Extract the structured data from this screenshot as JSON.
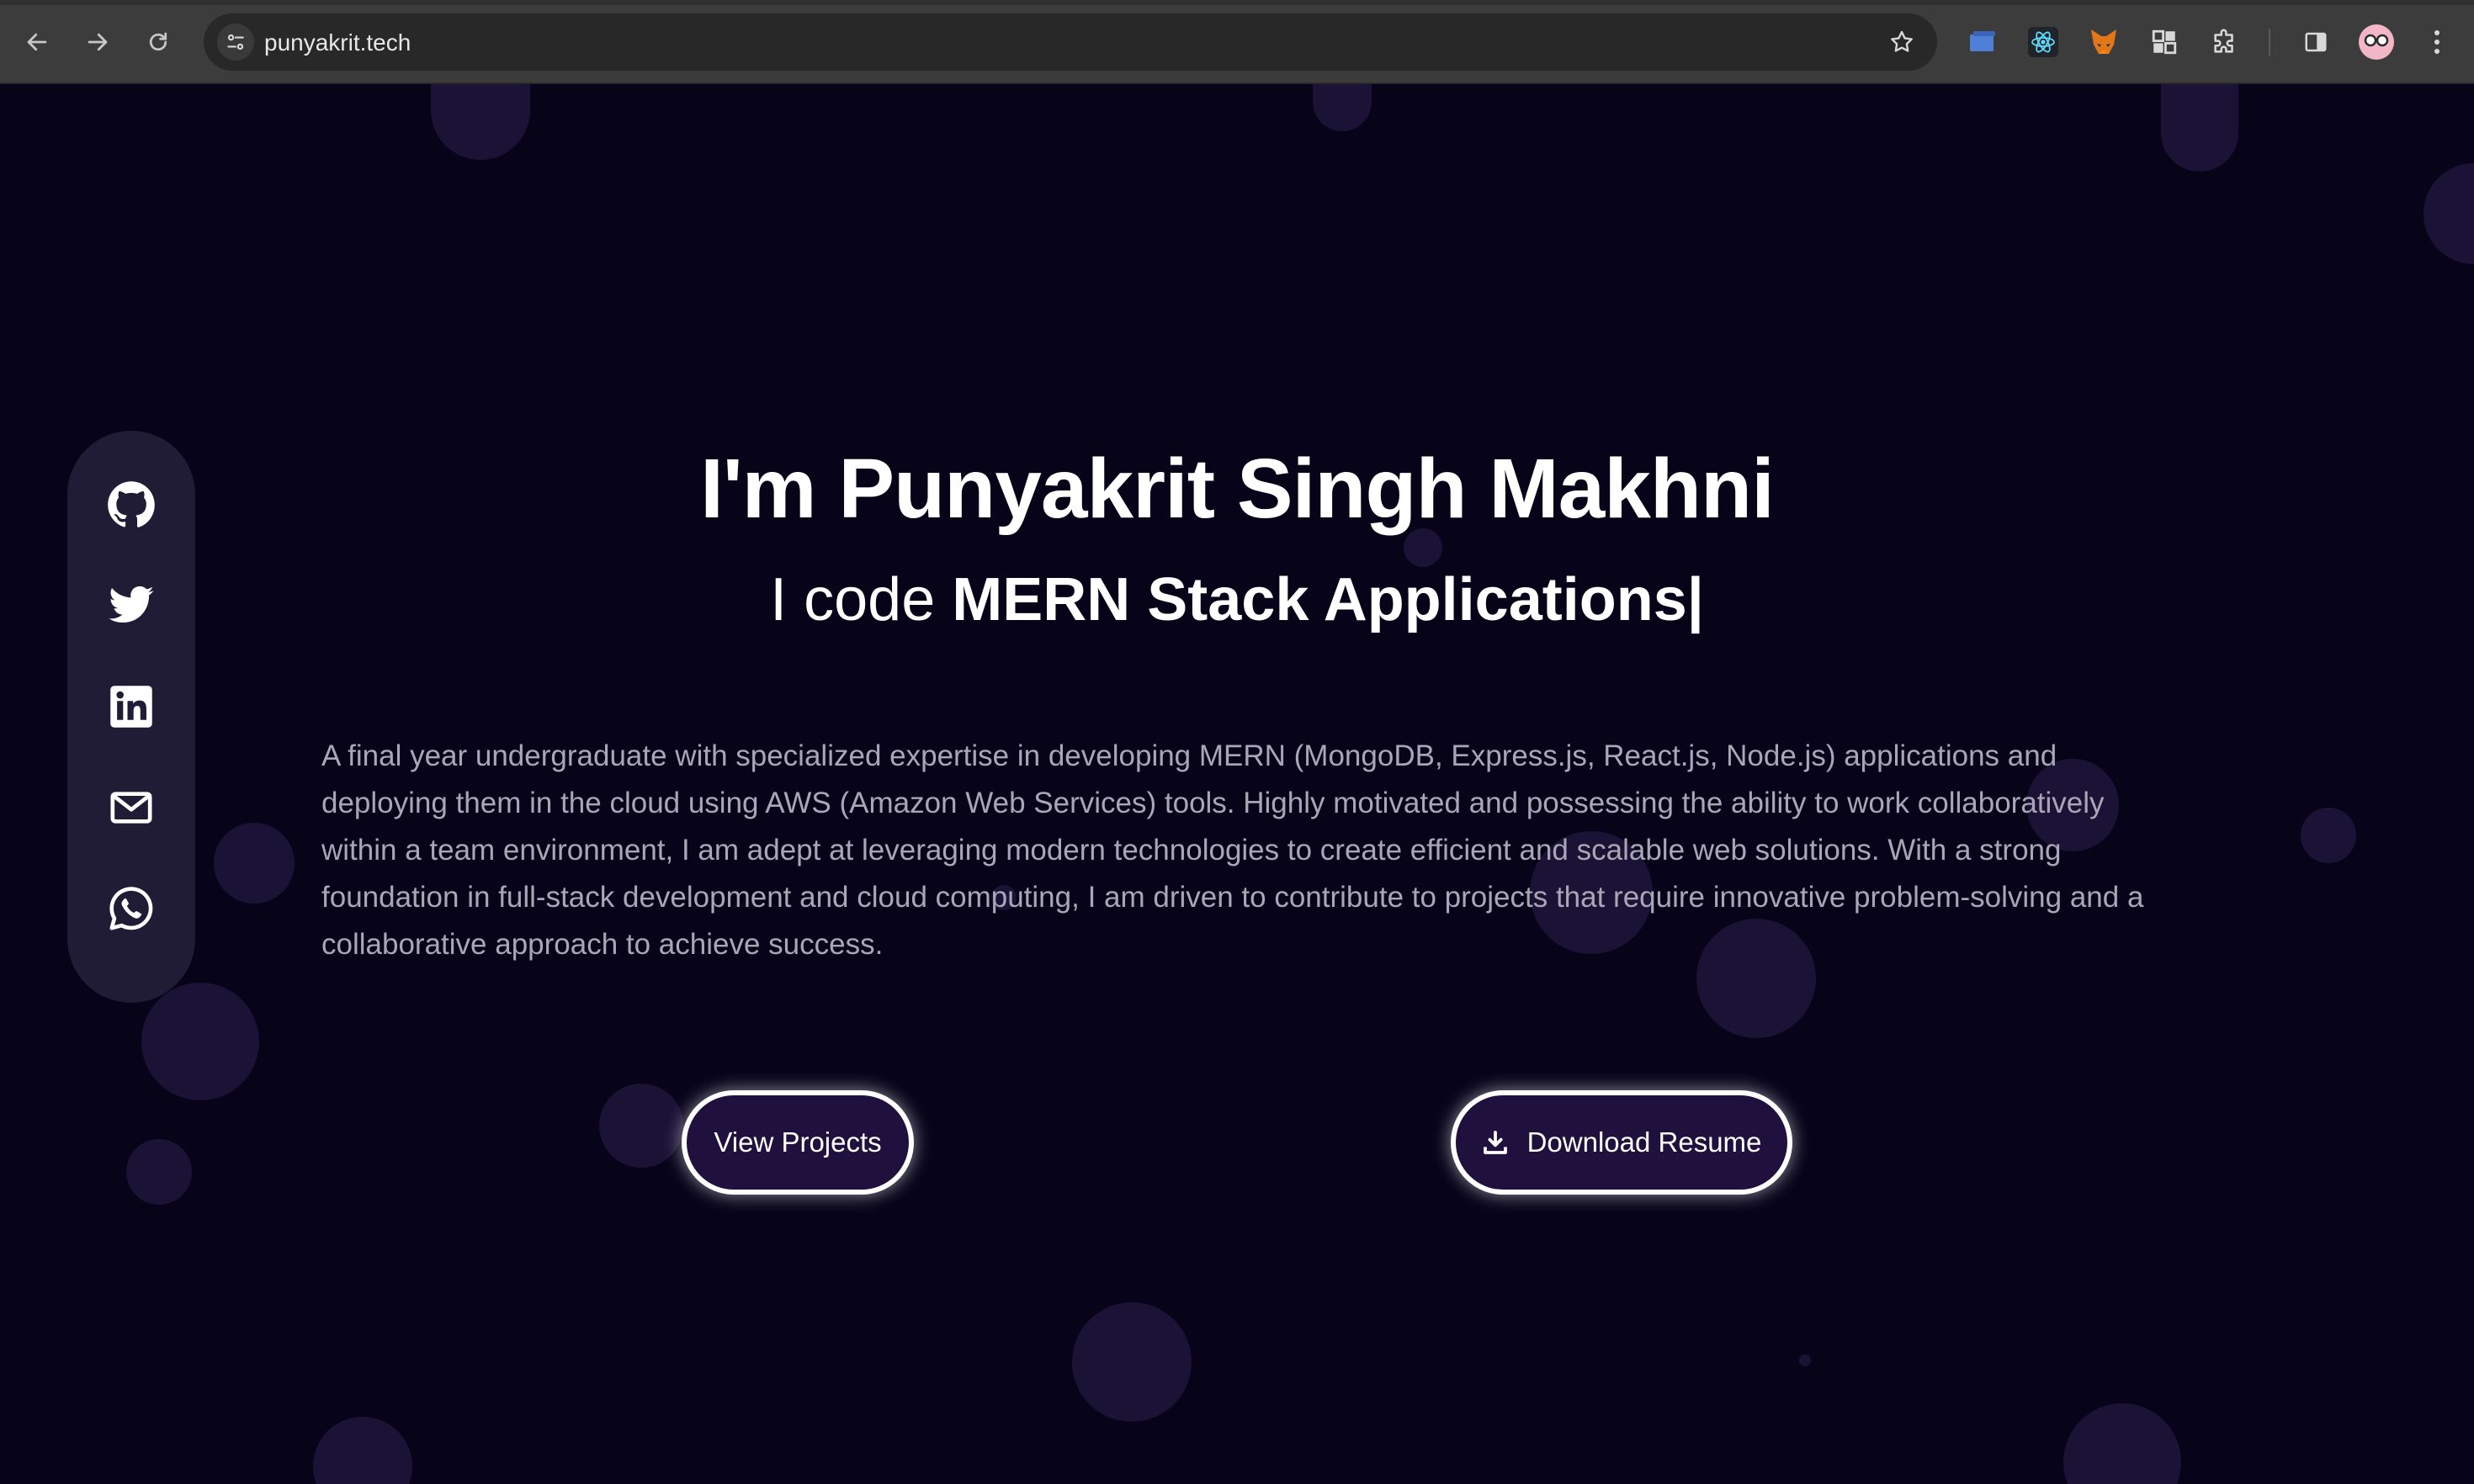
{
  "browser": {
    "url": "punyakrit.tech",
    "nav": {
      "back_icon": "arrow-left-icon",
      "forward_icon": "arrow-right-icon",
      "reload_icon": "reload-icon"
    },
    "extensions": [
      "window-icon",
      "react-devtools-icon",
      "metamask-fox-icon",
      "puzzle-grid-icon",
      "extensions-puzzle-icon",
      "sidebar-icon",
      "profile-avatar-icon",
      "more-menu-icon"
    ]
  },
  "hero": {
    "title": "I'm Punyakrit Singh Makhni",
    "subtitle_prefix": "I code ",
    "subtitle_emphasis": "MERN Stack Applications|",
    "bio": "A final year undergraduate with specialized expertise in developing MERN (MongoDB, Express.js, React.js, Node.js) applications and deploying them in the cloud using AWS (Amazon Web Services) tools. Highly motivated and possessing the ability to work collaboratively within a team environment, I am adept at leveraging modern technologies to create efficient and scalable web solutions. With a strong foundation in full-stack development and cloud computing, I am driven to contribute to projects that require innovative problem-solving and a collaborative approach to achieve success."
  },
  "buttons": {
    "view_projects": "View Projects",
    "download_resume": "Download Resume"
  },
  "social": [
    "github-icon",
    "twitter-icon",
    "linkedin-icon",
    "mail-icon",
    "whatsapp-icon"
  ],
  "colors": {
    "background": "#07041a",
    "rail": "#211c35",
    "button_fill": "#20103d",
    "text_muted": "#a9a6b6"
  }
}
